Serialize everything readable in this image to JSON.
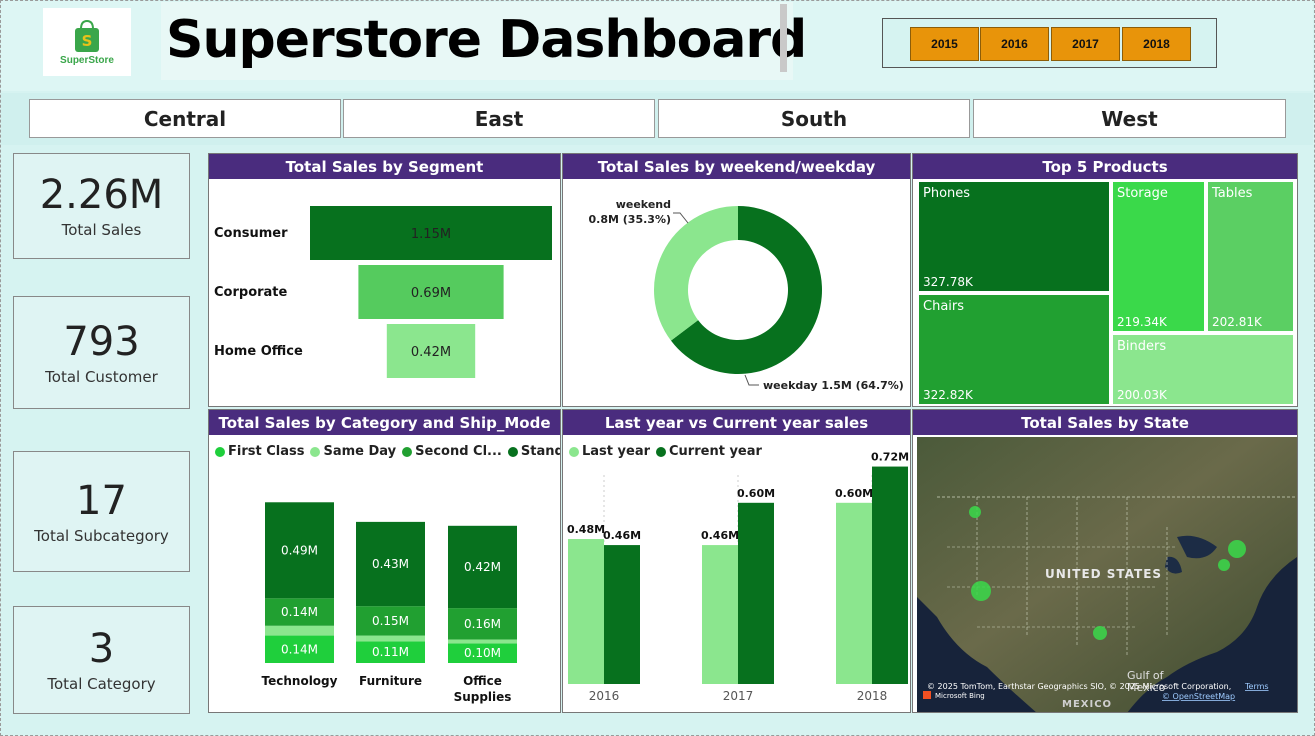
{
  "header": {
    "logo_text": "SuperStore",
    "logo_icon": "shopping-bag-icon",
    "title": "Superstore Dashboard"
  },
  "years": [
    "2015",
    "2016",
    "2017",
    "2018"
  ],
  "regions": [
    "Central",
    "East",
    "South",
    "West"
  ],
  "kpis": [
    {
      "value": "2.26M",
      "label": "Total Sales"
    },
    {
      "value": "793",
      "label": "Total Customer"
    },
    {
      "value": "17",
      "label": "Total Subcategory"
    },
    {
      "value": "3",
      "label": "Total Category"
    }
  ],
  "panels": {
    "segment": "Total Sales by Segment",
    "weekend": "Total Sales by weekend/weekday",
    "top5": "Top 5 Products",
    "category": "Total Sales by Category and Ship_Mode",
    "yoy": "Last year vs Current year sales",
    "state": "Total Sales by State"
  },
  "colors": {
    "accent_purple": "#4a2c7e",
    "year_orange": "#e8940a",
    "dark_green": "#07711e",
    "mid_green": "#21a031",
    "bright_green": "#3ad94a",
    "light_green": "#8be68e"
  },
  "chart_data": [
    {
      "type": "bar",
      "title": "Total Sales by Segment",
      "categories": [
        "Consumer",
        "Corporate",
        "Home Office"
      ],
      "values": [
        1.15,
        0.69,
        0.42
      ],
      "labels": [
        "1.15M",
        "0.69M",
        "0.42M"
      ],
      "unit": "M"
    },
    {
      "type": "pie",
      "title": "Total Sales by weekend/weekday",
      "slices": [
        {
          "name": "weekend",
          "value": 0.8,
          "pct": 35.3,
          "label": "0.8M (35.3%)"
        },
        {
          "name": "weekday",
          "value": 1.5,
          "pct": 64.7,
          "label": "1.5M (64.7%)"
        }
      ]
    },
    {
      "type": "heatmap",
      "title": "Top 5 Products",
      "items": [
        {
          "name": "Phones",
          "label": "327.78K",
          "value": 327.78
        },
        {
          "name": "Chairs",
          "label": "322.82K",
          "value": 322.82
        },
        {
          "name": "Storage",
          "label": "219.34K",
          "value": 219.34
        },
        {
          "name": "Tables",
          "label": "202.81K",
          "value": 202.81
        },
        {
          "name": "Binders",
          "label": "200.03K",
          "value": 200.03
        }
      ]
    },
    {
      "type": "bar",
      "title": "Total Sales by Category and Ship_Mode",
      "stacked": true,
      "categories": [
        "Technology",
        "Furniture",
        "Office Supplies"
      ],
      "series": [
        {
          "name": "First Class",
          "values": [
            0.14,
            0.11,
            0.1
          ],
          "labels": [
            "0.14M",
            "0.11M",
            "0.10M"
          ]
        },
        {
          "name": "Same Day",
          "values": [
            0.05,
            0.03,
            0.02
          ],
          "labels": [
            "",
            "",
            ""
          ]
        },
        {
          "name": "Second Cl...",
          "values": [
            0.14,
            0.15,
            0.16
          ],
          "labels": [
            "0.14M",
            "0.15M",
            "0.16M"
          ]
        },
        {
          "name": "Standar...",
          "values": [
            0.49,
            0.43,
            0.42
          ],
          "labels": [
            "0.49M",
            "0.43M",
            "0.42M"
          ]
        }
      ]
    },
    {
      "type": "bar",
      "title": "Last year vs Current year sales",
      "categories": [
        "2016",
        "2017",
        "2018"
      ],
      "series": [
        {
          "name": "Last year",
          "values": [
            0.48,
            0.46,
            0.6
          ],
          "labels": [
            "0.48M",
            "0.46M",
            "0.60M"
          ]
        },
        {
          "name": "Current year",
          "values": [
            0.46,
            0.6,
            0.72
          ],
          "labels": [
            "0.46M",
            "0.60M",
            "0.72M"
          ]
        }
      ]
    }
  ],
  "map": {
    "country_label": "UNITED STATES",
    "mexico_label": "MEXICO",
    "gulf_label": "Gulf of Mexico",
    "attribution": "© 2025 TomTom, Earthstar Geographics SIO, © 2025 Microsoft Corporation,",
    "terms": "Terms",
    "osm": "© OpenStreetMap",
    "bing": "Microsoft Bing"
  }
}
